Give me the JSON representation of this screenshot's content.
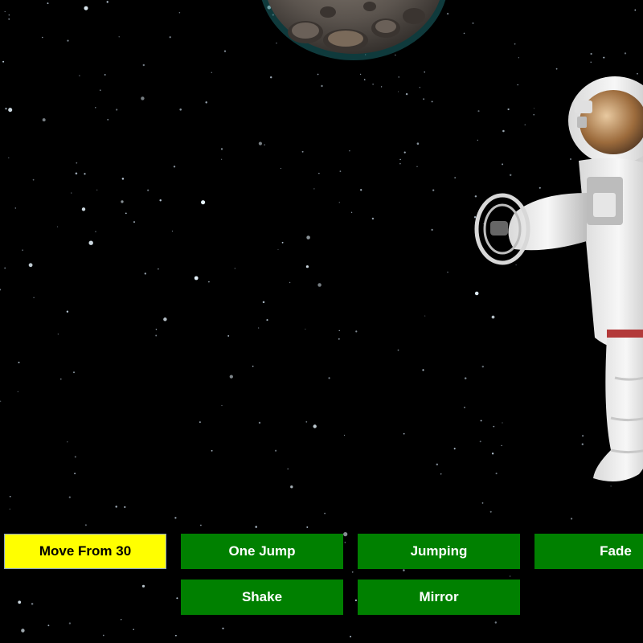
{
  "scene": {
    "background_color": "#000000",
    "moon_icon": "cratered-moon",
    "astronaut_icon": "floating-astronaut"
  },
  "controls": {
    "move_from_label": "Move From 30",
    "one_jump_label": "One Jump",
    "jumping_label": "Jumping",
    "fade_label": "Fade",
    "shake_label": "Shake",
    "mirror_label": "Mirror",
    "active_color": "#ffff00",
    "button_color": "#008000"
  }
}
